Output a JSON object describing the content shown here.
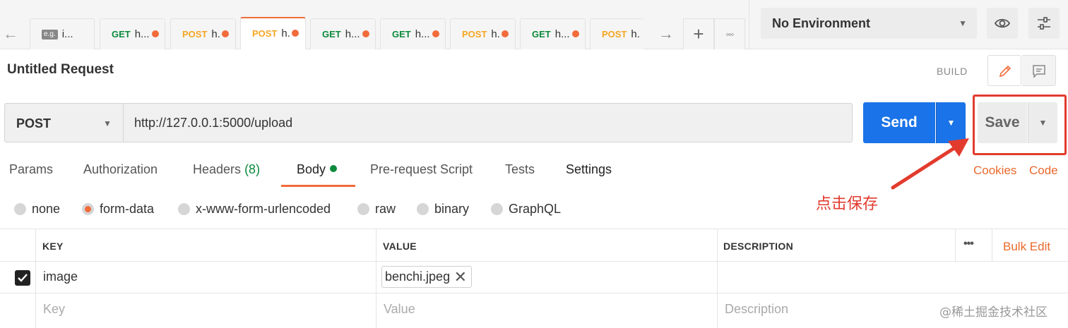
{
  "tabs": [
    {
      "method": "",
      "method_class": "eg",
      "badge": "e.g.",
      "name": "i...",
      "dirty": false,
      "active": false
    },
    {
      "method": "GET",
      "method_class": "get",
      "name": "h...",
      "dirty": true,
      "active": false
    },
    {
      "method": "POST",
      "method_class": "post",
      "name": "h.",
      "dirty": true,
      "active": false
    },
    {
      "method": "POST",
      "method_class": "post",
      "name": "h.",
      "dirty": true,
      "active": true
    },
    {
      "method": "GET",
      "method_class": "get",
      "name": "h...",
      "dirty": true,
      "active": false
    },
    {
      "method": "GET",
      "method_class": "get",
      "name": "h...",
      "dirty": true,
      "active": false
    },
    {
      "method": "POST",
      "method_class": "post",
      "name": "h.",
      "dirty": true,
      "active": false
    },
    {
      "method": "GET",
      "method_class": "get",
      "name": "h...",
      "dirty": true,
      "active": false
    },
    {
      "method": "POST",
      "method_class": "post",
      "name": "h.",
      "dirty": false,
      "active": false
    }
  ],
  "environment": {
    "selected": "No Environment"
  },
  "request": {
    "title": "Untitled Request",
    "build_label": "BUILD",
    "method": "POST",
    "url": "http://127.0.0.1:5000/upload",
    "send_label": "Send",
    "save_label": "Save"
  },
  "request_tabs": {
    "params": "Params",
    "authorization": "Authorization",
    "headers": "Headers",
    "headers_count": "(8)",
    "body": "Body",
    "pre_request": "Pre-request Script",
    "tests": "Tests",
    "settings": "Settings",
    "cookies": "Cookies",
    "code": "Code"
  },
  "body_types": {
    "none": "none",
    "form_data": "form-data",
    "urlencoded": "x-www-form-urlencoded",
    "raw": "raw",
    "binary": "binary",
    "graphql": "GraphQL",
    "selected": "form-data"
  },
  "table": {
    "headers": {
      "key": "KEY",
      "value": "VALUE",
      "description": "DESCRIPTION"
    },
    "bulk_edit": "Bulk Edit",
    "rows": [
      {
        "checked": true,
        "key": "image",
        "value": "benchi.jpeg",
        "description": ""
      }
    ],
    "placeholder": {
      "key": "Key",
      "value": "Value",
      "description": "Description"
    }
  },
  "annotation": {
    "text": "点击保存",
    "color": "#e23b2e"
  },
  "watermark": "@稀土掘金技术社区",
  "colors": {
    "accent": "#f26b3a",
    "send": "#1a73e8",
    "get": "#0b8a3c",
    "post": "#f5a623"
  }
}
